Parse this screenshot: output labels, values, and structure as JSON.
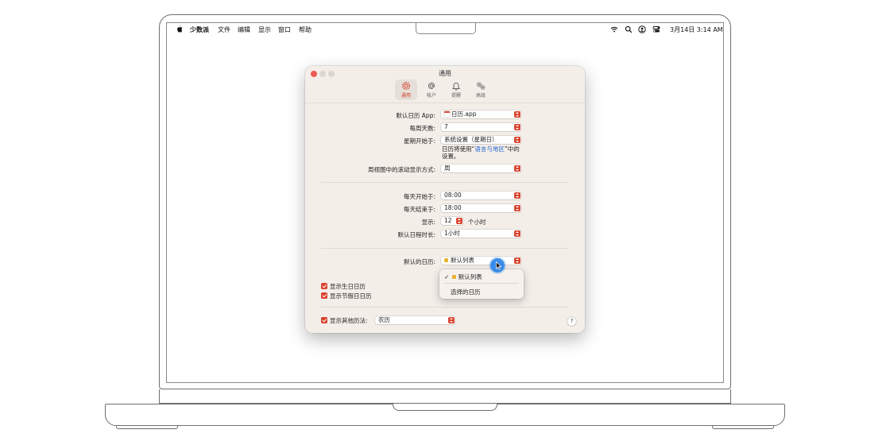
{
  "menubar": {
    "app_name": "少数派",
    "menus": [
      "文件",
      "编辑",
      "显示",
      "窗口",
      "帮助"
    ],
    "clock": "3月14日  3:14 AM",
    "status_icons": [
      "wifi-icon",
      "search-icon",
      "user-icon",
      "control-center-icon"
    ]
  },
  "window": {
    "title": "通用",
    "tabs": [
      {
        "label": "通用",
        "icon": "gear-icon",
        "selected": true
      },
      {
        "label": "帐户",
        "icon": "at-icon",
        "selected": false
      },
      {
        "label": "提醒",
        "icon": "bell-icon",
        "selected": false
      },
      {
        "label": "高级",
        "icon": "gears-icon",
        "selected": false
      }
    ]
  },
  "settings": {
    "default_app": {
      "label": "默认日历 App:",
      "value": "日历.app"
    },
    "days_per_week": {
      "label": "每周天数:",
      "value": "7"
    },
    "week_starts": {
      "label": "星期开始于:",
      "value": "系统设置（星期日）"
    },
    "week_hint": {
      "prefix": "日历将使用“",
      "link": "语言与地区",
      "suffix": "”中的",
      "line2": "设置。"
    },
    "scroll_by": {
      "label": "周视图中的滚动显示方式:",
      "value": "周"
    },
    "day_starts": {
      "label": "每天开始于:",
      "value": "08:00"
    },
    "day_ends": {
      "label": "每天结束于:",
      "value": "18:00"
    },
    "show_hours": {
      "label": "显示:",
      "value": "12",
      "unit": "个小时"
    },
    "default_duration": {
      "label": "默认日程时长:",
      "value": "1小时"
    },
    "default_calendar": {
      "label": "默认的日历:",
      "value": "默认列表"
    },
    "show_birthdays": {
      "label": "显示生日日历",
      "checked": true
    },
    "show_holidays": {
      "label": "显示节假日日历",
      "checked": true
    },
    "alt_calendar": {
      "label": "显示其他历法:",
      "value": "农历",
      "checked": true
    }
  },
  "dropdown": {
    "items": [
      {
        "label": "默认列表",
        "checked": true,
        "color": "#e9b434"
      },
      {
        "label": "选择的日历",
        "checked": false
      }
    ]
  },
  "help_label": "?",
  "checkmark": "✓",
  "colors": {
    "accent": "#d9432e",
    "window_bg": "#f4eee9",
    "link": "#1e66d0",
    "calendar_swatch": "#e9b434"
  }
}
